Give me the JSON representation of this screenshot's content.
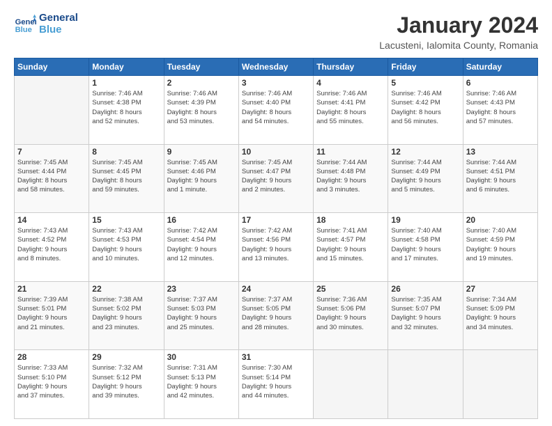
{
  "header": {
    "logo_line1": "General",
    "logo_line2": "Blue",
    "title": "January 2024",
    "subtitle": "Lacusteni, Ialomita County, Romania"
  },
  "calendar": {
    "days_of_week": [
      "Sunday",
      "Monday",
      "Tuesday",
      "Wednesday",
      "Thursday",
      "Friday",
      "Saturday"
    ],
    "weeks": [
      [
        {
          "day": "",
          "info": ""
        },
        {
          "day": "1",
          "info": "Sunrise: 7:46 AM\nSunset: 4:38 PM\nDaylight: 8 hours\nand 52 minutes."
        },
        {
          "day": "2",
          "info": "Sunrise: 7:46 AM\nSunset: 4:39 PM\nDaylight: 8 hours\nand 53 minutes."
        },
        {
          "day": "3",
          "info": "Sunrise: 7:46 AM\nSunset: 4:40 PM\nDaylight: 8 hours\nand 54 minutes."
        },
        {
          "day": "4",
          "info": "Sunrise: 7:46 AM\nSunset: 4:41 PM\nDaylight: 8 hours\nand 55 minutes."
        },
        {
          "day": "5",
          "info": "Sunrise: 7:46 AM\nSunset: 4:42 PM\nDaylight: 8 hours\nand 56 minutes."
        },
        {
          "day": "6",
          "info": "Sunrise: 7:46 AM\nSunset: 4:43 PM\nDaylight: 8 hours\nand 57 minutes."
        }
      ],
      [
        {
          "day": "7",
          "info": "Sunrise: 7:45 AM\nSunset: 4:44 PM\nDaylight: 8 hours\nand 58 minutes."
        },
        {
          "day": "8",
          "info": "Sunrise: 7:45 AM\nSunset: 4:45 PM\nDaylight: 8 hours\nand 59 minutes."
        },
        {
          "day": "9",
          "info": "Sunrise: 7:45 AM\nSunset: 4:46 PM\nDaylight: 9 hours\nand 1 minute."
        },
        {
          "day": "10",
          "info": "Sunrise: 7:45 AM\nSunset: 4:47 PM\nDaylight: 9 hours\nand 2 minutes."
        },
        {
          "day": "11",
          "info": "Sunrise: 7:44 AM\nSunset: 4:48 PM\nDaylight: 9 hours\nand 3 minutes."
        },
        {
          "day": "12",
          "info": "Sunrise: 7:44 AM\nSunset: 4:49 PM\nDaylight: 9 hours\nand 5 minutes."
        },
        {
          "day": "13",
          "info": "Sunrise: 7:44 AM\nSunset: 4:51 PM\nDaylight: 9 hours\nand 6 minutes."
        }
      ],
      [
        {
          "day": "14",
          "info": "Sunrise: 7:43 AM\nSunset: 4:52 PM\nDaylight: 9 hours\nand 8 minutes."
        },
        {
          "day": "15",
          "info": "Sunrise: 7:43 AM\nSunset: 4:53 PM\nDaylight: 9 hours\nand 10 minutes."
        },
        {
          "day": "16",
          "info": "Sunrise: 7:42 AM\nSunset: 4:54 PM\nDaylight: 9 hours\nand 12 minutes."
        },
        {
          "day": "17",
          "info": "Sunrise: 7:42 AM\nSunset: 4:56 PM\nDaylight: 9 hours\nand 13 minutes."
        },
        {
          "day": "18",
          "info": "Sunrise: 7:41 AM\nSunset: 4:57 PM\nDaylight: 9 hours\nand 15 minutes."
        },
        {
          "day": "19",
          "info": "Sunrise: 7:40 AM\nSunset: 4:58 PM\nDaylight: 9 hours\nand 17 minutes."
        },
        {
          "day": "20",
          "info": "Sunrise: 7:40 AM\nSunset: 4:59 PM\nDaylight: 9 hours\nand 19 minutes."
        }
      ],
      [
        {
          "day": "21",
          "info": "Sunrise: 7:39 AM\nSunset: 5:01 PM\nDaylight: 9 hours\nand 21 minutes."
        },
        {
          "day": "22",
          "info": "Sunrise: 7:38 AM\nSunset: 5:02 PM\nDaylight: 9 hours\nand 23 minutes."
        },
        {
          "day": "23",
          "info": "Sunrise: 7:37 AM\nSunset: 5:03 PM\nDaylight: 9 hours\nand 25 minutes."
        },
        {
          "day": "24",
          "info": "Sunrise: 7:37 AM\nSunset: 5:05 PM\nDaylight: 9 hours\nand 28 minutes."
        },
        {
          "day": "25",
          "info": "Sunrise: 7:36 AM\nSunset: 5:06 PM\nDaylight: 9 hours\nand 30 minutes."
        },
        {
          "day": "26",
          "info": "Sunrise: 7:35 AM\nSunset: 5:07 PM\nDaylight: 9 hours\nand 32 minutes."
        },
        {
          "day": "27",
          "info": "Sunrise: 7:34 AM\nSunset: 5:09 PM\nDaylight: 9 hours\nand 34 minutes."
        }
      ],
      [
        {
          "day": "28",
          "info": "Sunrise: 7:33 AM\nSunset: 5:10 PM\nDaylight: 9 hours\nand 37 minutes."
        },
        {
          "day": "29",
          "info": "Sunrise: 7:32 AM\nSunset: 5:12 PM\nDaylight: 9 hours\nand 39 minutes."
        },
        {
          "day": "30",
          "info": "Sunrise: 7:31 AM\nSunset: 5:13 PM\nDaylight: 9 hours\nand 42 minutes."
        },
        {
          "day": "31",
          "info": "Sunrise: 7:30 AM\nSunset: 5:14 PM\nDaylight: 9 hours\nand 44 minutes."
        },
        {
          "day": "",
          "info": ""
        },
        {
          "day": "",
          "info": ""
        },
        {
          "day": "",
          "info": ""
        }
      ]
    ]
  }
}
